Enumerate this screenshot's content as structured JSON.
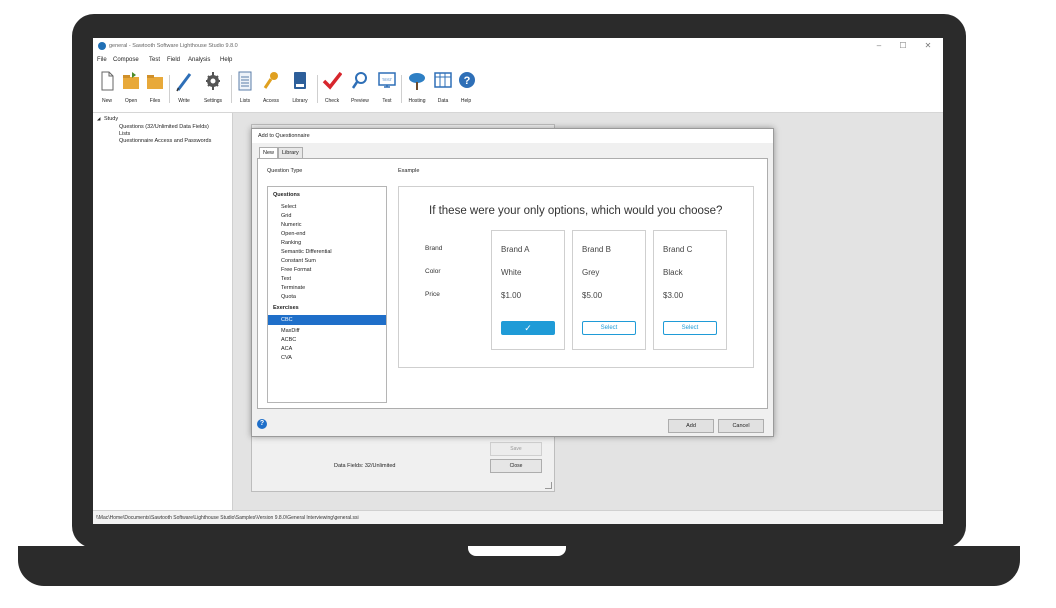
{
  "window": {
    "title": "general - Sawtooth Software Lighthouse Studio 9.8.0",
    "minimize": "–",
    "maximize": "☐",
    "close": "✕"
  },
  "menu": [
    "File",
    "Compose",
    "Test",
    "Field",
    "Analysis",
    "Help"
  ],
  "toolbar": [
    {
      "label": "New",
      "icon": "new-file-icon"
    },
    {
      "label": "Open",
      "icon": "open-folder-icon"
    },
    {
      "label": "Files",
      "icon": "files-folder-icon"
    },
    {
      "label": "Write",
      "icon": "pencil-icon"
    },
    {
      "label": "Settings",
      "icon": "gear-icon"
    },
    {
      "label": "Lists",
      "icon": "list-icon"
    },
    {
      "label": "Access",
      "icon": "key-icon"
    },
    {
      "label": "Library",
      "icon": "library-icon"
    },
    {
      "label": "Check",
      "icon": "checkmark-icon"
    },
    {
      "label": "Preview",
      "icon": "magnifier-icon"
    },
    {
      "label": "Test",
      "icon": "test-monitor-icon"
    },
    {
      "label": "Hosting",
      "icon": "cloud-tree-icon"
    },
    {
      "label": "Data",
      "icon": "data-table-icon"
    },
    {
      "label": "Help",
      "icon": "help-icon"
    }
  ],
  "toolbar_test_icon_text": "TEST",
  "tree": {
    "root": "Study",
    "expander": "◢",
    "children": [
      "Questions (32/Unlimited Data Fields)",
      "Lists",
      "Questionnaire Access and Passwords"
    ]
  },
  "back_window": {
    "save": "Save",
    "close": "Close",
    "data_fields": "Data Fields: 32/Unlimited"
  },
  "dialog": {
    "title": "Add to Questionnaire",
    "tabs": [
      "New",
      "Library"
    ],
    "question_type_label": "Question Type",
    "example_label": "Example",
    "sections": [
      {
        "heading": "Questions",
        "items": [
          "Select",
          "Grid",
          "Numeric",
          "Open-end",
          "Ranking",
          "Semantic Differential",
          "Constant Sum",
          "Free Format",
          "Text",
          "Terminate",
          "Quota"
        ]
      },
      {
        "heading": "Exercises",
        "items": [
          "CBC",
          "MaxDiff",
          "ACBC",
          "ACA",
          "CVA"
        ]
      }
    ],
    "selected_item": "CBC",
    "add": "Add",
    "cancel": "Cancel",
    "help": "?"
  },
  "example": {
    "question": "If these were your only options, which would you choose?",
    "attributes": [
      "Brand",
      "Color",
      "Price"
    ],
    "cards": [
      {
        "values": [
          "Brand A",
          "White",
          "$1.00"
        ],
        "button": "✓",
        "selected": true
      },
      {
        "values": [
          "Brand B",
          "Grey",
          "$5.00"
        ],
        "button": "Select",
        "selected": false
      },
      {
        "values": [
          "Brand C",
          "Black",
          "$3.00"
        ],
        "button": "Select",
        "selected": false
      }
    ]
  },
  "status": "\\\\Mac\\Home\\Documents\\Sawtooth Software\\Lighthouse Studio\\Samples\\Version 9.8.0\\General Interviewing\\general.ssi",
  "colors": {
    "accent": "#1f9bd7",
    "selection": "#1f6fc9",
    "laptop": "#2b2b2b"
  }
}
